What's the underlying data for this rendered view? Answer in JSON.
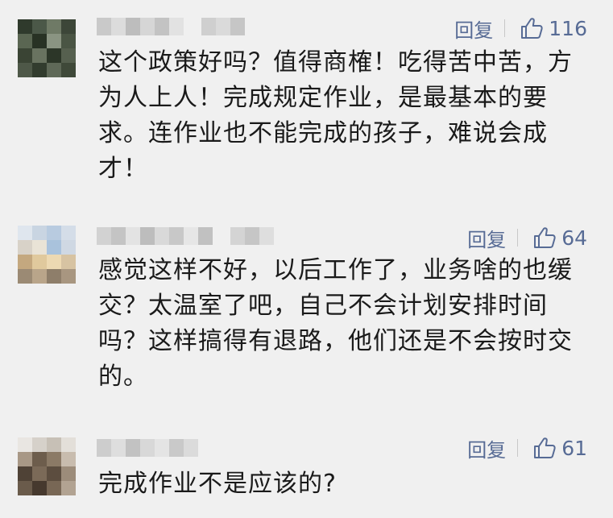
{
  "comments": [
    {
      "reply_label": "回复",
      "likes": "116",
      "text": "这个政策好吗？值得商榷！吃得苦中苦，方\n为人上人！完成规定作业，是最基本的要\n求。连作业也不能完成的孩子，难说会成\n才！"
    },
    {
      "reply_label": "回复",
      "likes": "64",
      "text": "感觉这样不好，以后工作了，业务啥的也缓\n交？太温室了吧，自己不会计划安排时间\n吗？这样搞得有退路，他们还是不会按时交\n的。"
    },
    {
      "reply_label": "回复",
      "likes": "61",
      "text": "完成作业不是应该的?"
    }
  ],
  "colors": {
    "accent": "#576b95",
    "text": "#1a1a1a",
    "background": "#f0f0f0"
  },
  "icons": {
    "like": "thumbs-up-outline-icon"
  }
}
